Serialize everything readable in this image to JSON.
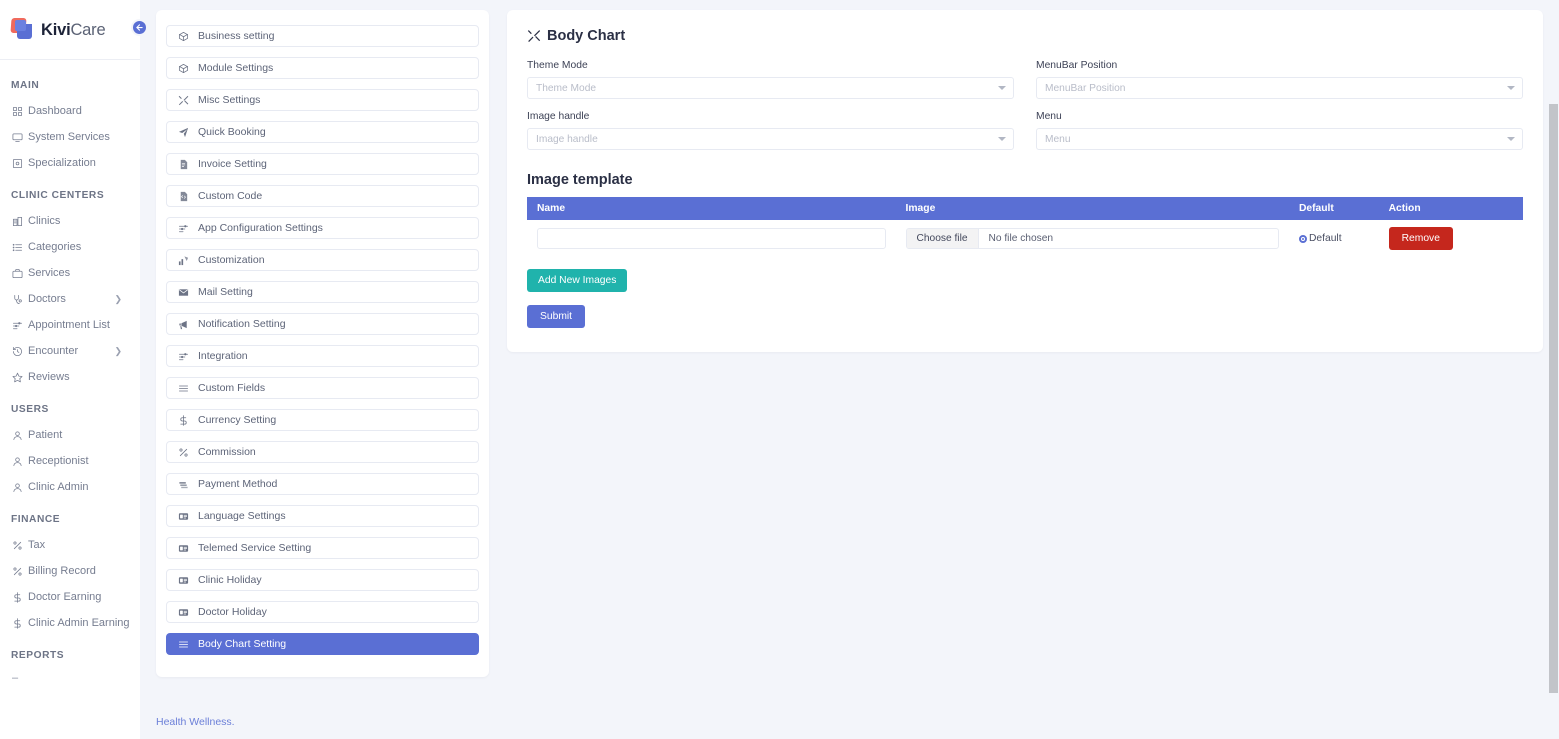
{
  "brand": {
    "bold": "Kivi",
    "light": "Care"
  },
  "collapse_button": {
    "icon": "arrow-left-icon",
    "label": "←"
  },
  "sidebar": {
    "sections": [
      {
        "title": "MAIN",
        "items": [
          {
            "label": "Dashboard",
            "icon": "grid-icon",
            "chevron": false
          },
          {
            "label": "System Services",
            "icon": "monitor-icon",
            "chevron": false
          },
          {
            "label": "Specialization",
            "icon": "badge-icon",
            "chevron": false
          }
        ]
      },
      {
        "title": "CLINIC CENTERS",
        "items": [
          {
            "label": "Clinics",
            "icon": "building-icon",
            "chevron": false
          },
          {
            "label": "Categories",
            "icon": "list-icon",
            "chevron": false
          },
          {
            "label": "Services",
            "icon": "briefcase-icon",
            "chevron": false
          },
          {
            "label": "Doctors",
            "icon": "stethoscope-icon",
            "chevron": true
          },
          {
            "label": "Appointment List",
            "icon": "sliders-icon",
            "chevron": false
          },
          {
            "label": "Encounter",
            "icon": "history-icon",
            "chevron": true
          },
          {
            "label": "Reviews",
            "icon": "star-icon",
            "chevron": false
          }
        ]
      },
      {
        "title": "USERS",
        "items": [
          {
            "label": "Patient",
            "icon": "user-icon",
            "chevron": false
          },
          {
            "label": "Receptionist",
            "icon": "user-icon",
            "chevron": false
          },
          {
            "label": "Clinic Admin",
            "icon": "user-icon",
            "chevron": false
          }
        ]
      },
      {
        "title": "FINANCE",
        "items": [
          {
            "label": "Tax",
            "icon": "percent-icon",
            "chevron": false
          },
          {
            "label": "Billing Record",
            "icon": "percent-icon",
            "chevron": false
          },
          {
            "label": "Doctor Earning",
            "icon": "dollar-icon",
            "chevron": false
          },
          {
            "label": "Clinic Admin Earning",
            "icon": "dollar-icon",
            "chevron": false
          }
        ]
      },
      {
        "title": "REPORTS",
        "items": []
      }
    ],
    "reports_placeholder": "–"
  },
  "settings_list": {
    "items": [
      {
        "label": "Business setting",
        "icon": "box-icon",
        "active": false
      },
      {
        "label": "Module Settings",
        "icon": "box-icon",
        "active": false
      },
      {
        "label": "Misc Settings",
        "icon": "tools-icon",
        "active": false
      },
      {
        "label": "Quick Booking",
        "icon": "send-icon",
        "active": false
      },
      {
        "label": "Invoice Setting",
        "icon": "invoice-icon",
        "active": false
      },
      {
        "label": "Custom Code",
        "icon": "code-file-icon",
        "active": false
      },
      {
        "label": "App Configuration Settings",
        "icon": "sliders-icon",
        "active": false
      },
      {
        "label": "Customization",
        "icon": "chart-up-icon",
        "active": false
      },
      {
        "label": "Mail Setting",
        "icon": "envelope-icon",
        "active": false
      },
      {
        "label": "Notification Setting",
        "icon": "megaphone-icon",
        "active": false
      },
      {
        "label": "Integration",
        "icon": "sliders-icon",
        "active": false
      },
      {
        "label": "Custom Fields",
        "icon": "hamburger-icon",
        "active": false
      },
      {
        "label": "Currency Setting",
        "icon": "dollar-icon",
        "active": false
      },
      {
        "label": "Commission",
        "icon": "percent-icon",
        "active": false
      },
      {
        "label": "Payment Method",
        "icon": "cards-icon",
        "active": false
      },
      {
        "label": "Language Settings",
        "icon": "id-card-icon",
        "active": false
      },
      {
        "label": "Telemed Service Setting",
        "icon": "id-card-icon",
        "active": false
      },
      {
        "label": "Clinic Holiday",
        "icon": "id-card-icon",
        "active": false
      },
      {
        "label": "Doctor Holiday",
        "icon": "id-card-icon",
        "active": false
      },
      {
        "label": "Body Chart Setting",
        "icon": "hamburger-icon",
        "active": true
      }
    ]
  },
  "body_chart": {
    "title": "Body Chart",
    "title_icon": "tools-icon",
    "fields": {
      "theme_mode": {
        "label": "Theme Mode",
        "placeholder": "Theme Mode",
        "value": ""
      },
      "menubar_position": {
        "label": "MenuBar Position",
        "placeholder": "MenuBar Position",
        "value": ""
      },
      "image_handle": {
        "label": "Image handle",
        "placeholder": "Image handle",
        "value": ""
      },
      "menu": {
        "label": "Menu",
        "placeholder": "Menu",
        "value": ""
      }
    },
    "image_template": {
      "title": "Image template",
      "headers": [
        "Name",
        "Image",
        "Default",
        "Action"
      ],
      "rows": [
        {
          "name_value": "",
          "name_placeholder": "",
          "file_button": "Choose file",
          "file_status": "No file chosen",
          "default_label": "Default",
          "default_selected": true,
          "action_label": "Remove"
        }
      ]
    },
    "add_images_button": "Add New Images",
    "submit_button": "Submit"
  },
  "footer": {
    "link": "Health Wellness."
  },
  "colors": {
    "primary": "#5a6fd4",
    "danger": "#c5271d",
    "teal": "#20b3ac",
    "page_bg": "#f3f5fa"
  }
}
